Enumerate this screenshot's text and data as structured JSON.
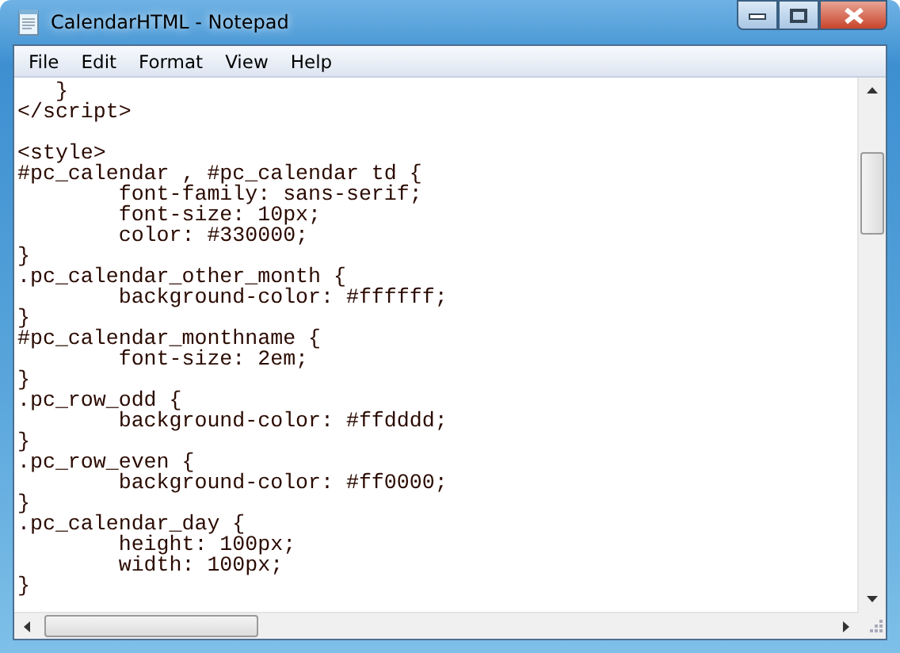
{
  "window": {
    "title": "CalendarHTML - Notepad"
  },
  "menu": [
    "File",
    "Edit",
    "Format",
    "View",
    "Help"
  ],
  "editor": {
    "blocks": [
      [
        "   }",
        "</script>"
      ],
      [
        "<style>",
        "#pc_calendar , #pc_calendar td {",
        "\tfont-family: sans-serif;",
        "\tfont-size: 10px;",
        "\tcolor: #330000;",
        "}",
        ".pc_calendar_other_month {",
        "\tbackground-color: #ffffff;",
        "}",
        "#pc_calendar_monthname {",
        "\tfont-size: 2em;",
        "}",
        ".pc_row_odd {",
        "\tbackground-color: #ffdddd;",
        "}",
        ".pc_row_even {",
        "\tbackground-color: #ff0000;",
        "}",
        ".pc_calendar_day {",
        "\theight: 100px;",
        "\twidth: 100px;",
        "}"
      ]
    ]
  }
}
